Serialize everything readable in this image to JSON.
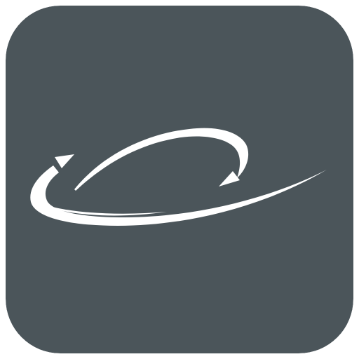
{
  "app_icon": {
    "icon_name": "orbit-arrows-logo-icon",
    "background_color": "#4b555a",
    "glyph_color": "#ffffff"
  }
}
